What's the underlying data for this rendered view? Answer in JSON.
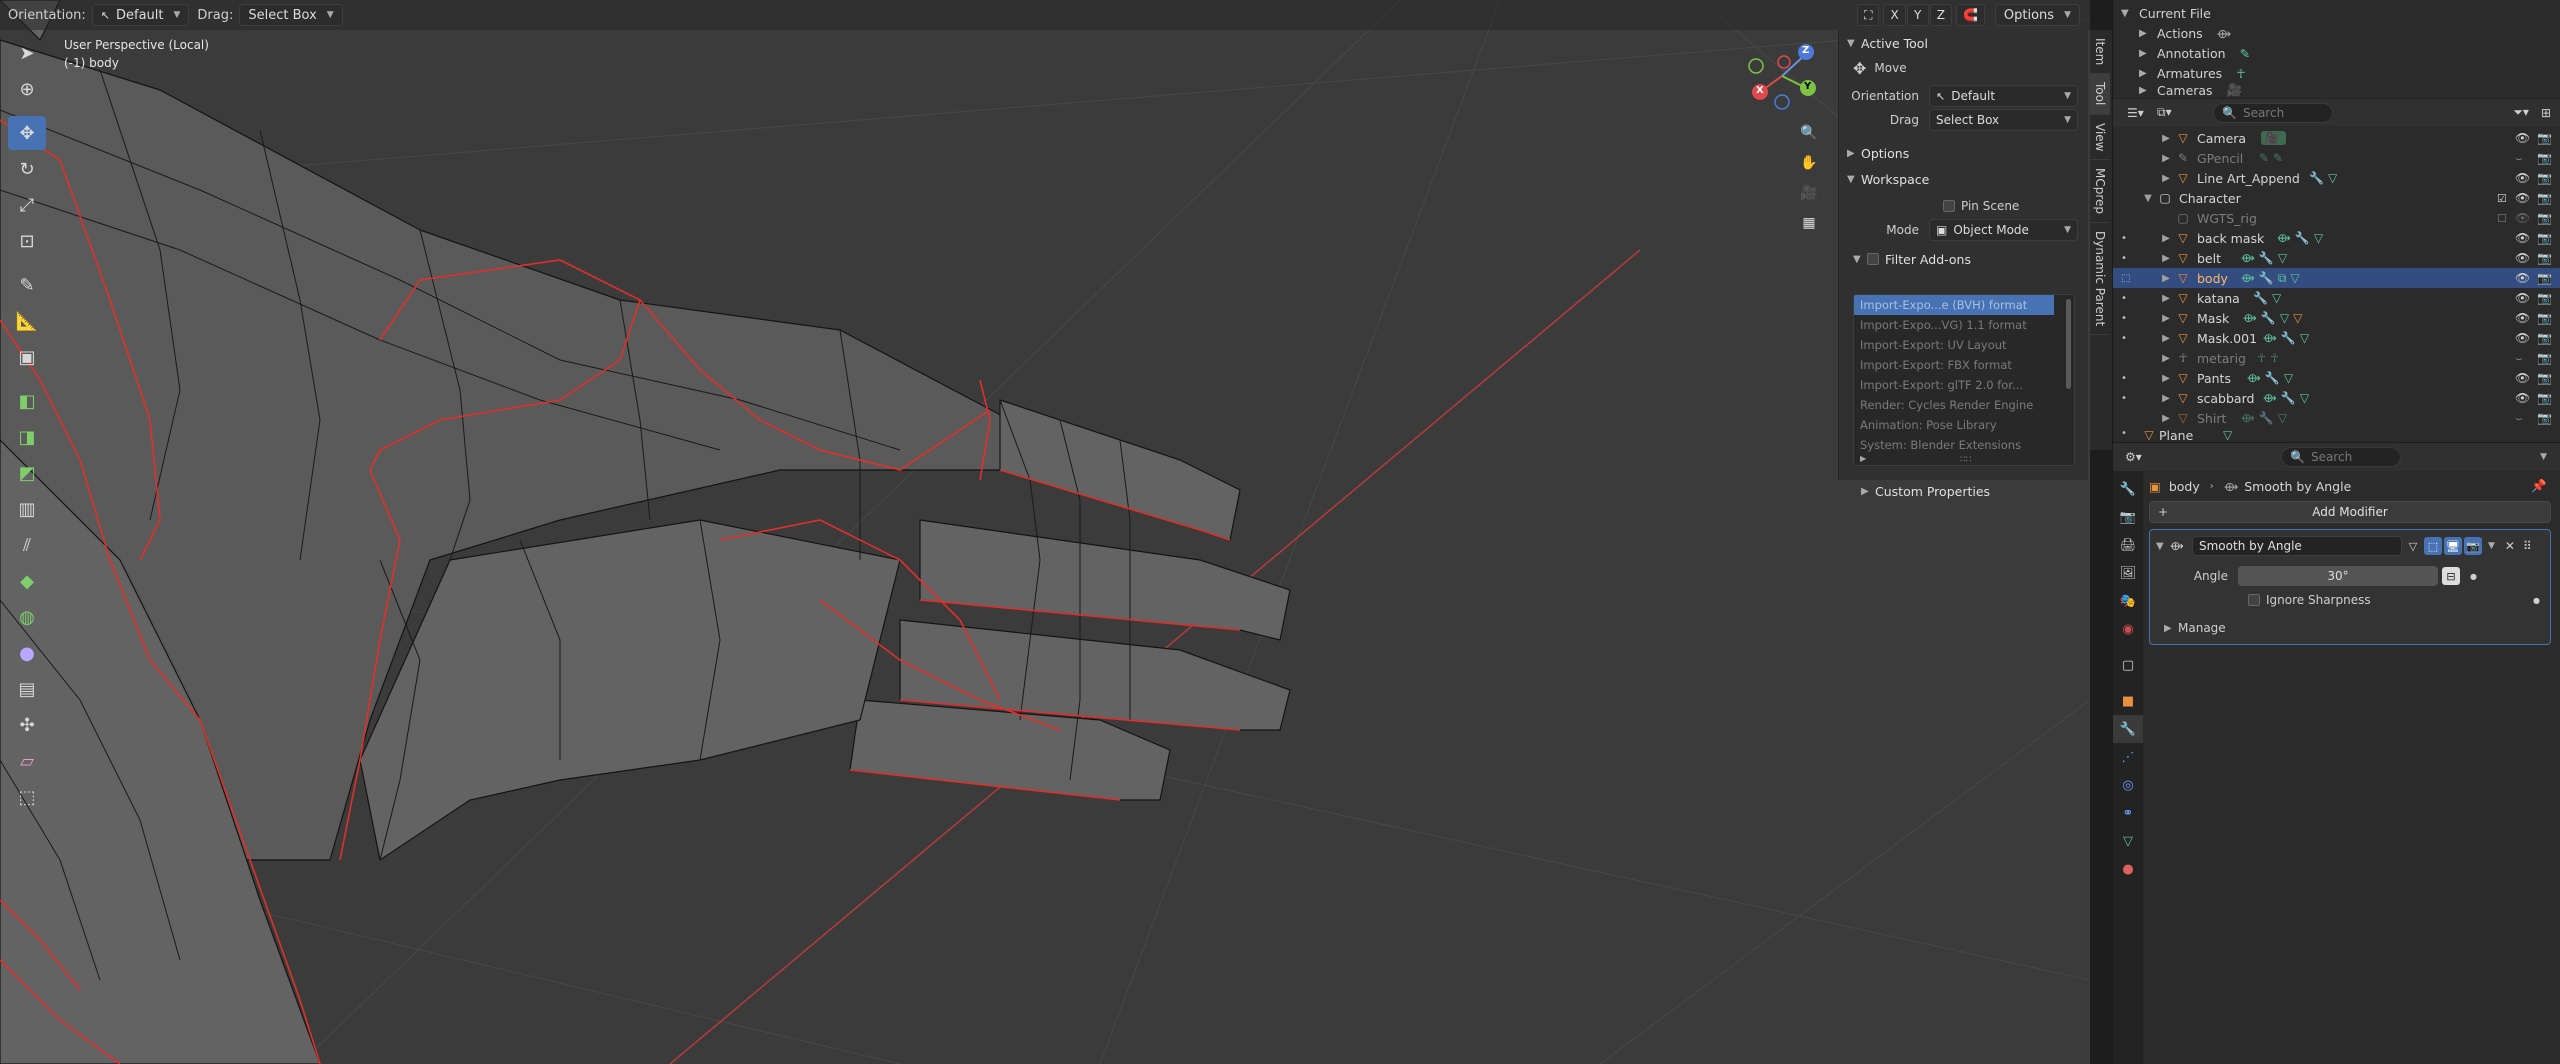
{
  "header": {
    "orientation_label": "Orientation:",
    "orientation_value": "Default",
    "drag_label": "Drag:",
    "drag_value": "Select Box",
    "axis_x": "X",
    "axis_y": "Y",
    "axis_z": "Z",
    "options_label": "Options"
  },
  "viewport": {
    "perspective": "User Perspective (Local)",
    "object": "(-1) body"
  },
  "gizmo": {
    "x": "X",
    "y": "Y",
    "z": "Z"
  },
  "npanel": {
    "active_tool_title": "Active Tool",
    "tool_name": "Move",
    "orientation_key": "Orientation",
    "orientation_value": "Default",
    "drag_key": "Drag",
    "drag_value": "Select Box",
    "options_title": "Options",
    "workspace_title": "Workspace",
    "pin_scene": "Pin Scene",
    "mode_key": "Mode",
    "mode_value": "Object Mode",
    "filter_addons": "Filter Add-ons",
    "addons": [
      "Import-Expo...e (BVH) format",
      "Import-Expo...VG) 1.1 format",
      "Import-Export: UV Layout",
      "Import-Export: FBX format",
      "Import-Export: glTF 2.0 for...",
      "Render: Cycles Render Engine",
      "Animation: Pose Library",
      "System: Blender Extensions"
    ],
    "custom_properties": "Custom Properties",
    "tabs": [
      "Item",
      "Tool",
      "View",
      "MCprep",
      "Dynamic Parent"
    ]
  },
  "outliner": {
    "current_file": "Current File",
    "data_items": [
      "Actions",
      "Annotation",
      "Armatures",
      "Cameras"
    ],
    "search_placeholder": "Search",
    "rows": [
      {
        "name": "Camera"
      },
      {
        "name": "GPencil"
      },
      {
        "name": "Line Art_Append"
      },
      {
        "name": "Character"
      },
      {
        "name": "WGTS_rig"
      },
      {
        "name": "back mask"
      },
      {
        "name": "belt"
      },
      {
        "name": "body"
      },
      {
        "name": "katana"
      },
      {
        "name": "Mask"
      },
      {
        "name": "Mask.001"
      },
      {
        "name": "metarig"
      },
      {
        "name": "Pants"
      },
      {
        "name": "scabbard"
      },
      {
        "name": "Shirt"
      },
      {
        "name": "Plane"
      }
    ]
  },
  "properties": {
    "search_placeholder": "Search",
    "crumb_object": "body",
    "crumb_modifier": "Smooth by Angle",
    "add_modifier": "Add Modifier",
    "modifier_name": "Smooth by Angle",
    "angle_label": "Angle",
    "angle_value": "30°",
    "ignore_sharpness": "Ignore Sharpness",
    "manage": "Manage"
  },
  "colors": {
    "accent": "#4772b3",
    "selected_row": "#334d80",
    "wire": "#1a1a1a",
    "seam": "#e0302a",
    "object_orange": "#e8903c",
    "modifier_teal": "#5ec4a0"
  }
}
